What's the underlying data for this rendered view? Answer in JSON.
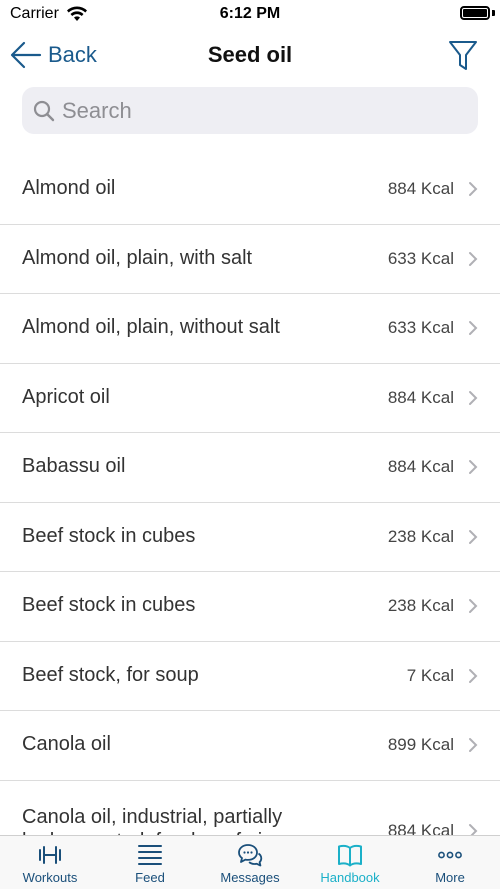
{
  "status_bar": {
    "carrier": "Carrier",
    "time": "6:12 PM"
  },
  "nav": {
    "back_label": "Back",
    "title": "Seed oil"
  },
  "search": {
    "placeholder": "Search",
    "value": ""
  },
  "foods": [
    {
      "name": "Almond oil",
      "kcal": "884 Kcal"
    },
    {
      "name": "Almond oil, plain, with salt",
      "kcal": "633 Kcal"
    },
    {
      "name": "Almond oil, plain, without salt",
      "kcal": "633 Kcal"
    },
    {
      "name": "Apricot oil",
      "kcal": "884 Kcal"
    },
    {
      "name": "Babassu oil",
      "kcal": "884 Kcal"
    },
    {
      "name": "Beef stock in cubes",
      "kcal": "238 Kcal"
    },
    {
      "name": "Beef stock in cubes",
      "kcal": "238 Kcal"
    },
    {
      "name": "Beef stock, for soup",
      "kcal": "7 Kcal"
    },
    {
      "name": "Canola oil",
      "kcal": "899 Kcal"
    },
    {
      "name": "Canola oil, industrial, partially hydrogenated, for deep-frying",
      "kcal": "884 Kcal"
    }
  ],
  "tabs": [
    {
      "label": "Workouts",
      "icon": "dumbbell-icon",
      "active": false
    },
    {
      "label": "Feed",
      "icon": "feed-icon",
      "active": false
    },
    {
      "label": "Messages",
      "icon": "messages-icon",
      "active": false
    },
    {
      "label": "Handbook",
      "icon": "book-icon",
      "active": true
    },
    {
      "label": "More",
      "icon": "more-icon",
      "active": false
    }
  ],
  "colors": {
    "accent": "#1a5a8c",
    "active_tab": "#1bb0c8",
    "search_bg": "#eeeef3"
  }
}
